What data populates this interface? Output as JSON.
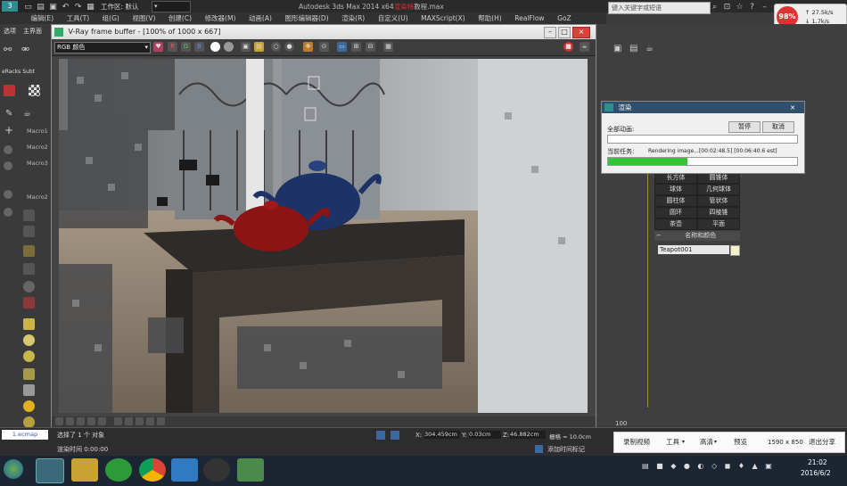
{
  "app": {
    "title_prefix": "Autodesk 3ds Max 2014 x64",
    "title_highlight": "渲染特",
    "title_suffix": "教程.max",
    "workspace_label": "工作区: 默认"
  },
  "menu": [
    "编辑(E)",
    "工具(T)",
    "组(G)",
    "视图(V)",
    "创建(C)",
    "修改器(M)",
    "动画(A)",
    "图形编辑器(D)",
    "渲染(R)",
    "自定义(U)",
    "MAXScript(X)",
    "帮助(H)",
    "RealFlow",
    "GoZ"
  ],
  "search": {
    "placeholder": "键入关键字或短语"
  },
  "net": {
    "cpu": "98%",
    "up": "27.5k/s",
    "down": "1.7k/s"
  },
  "left": {
    "tabs": [
      "选项",
      "主界面"
    ],
    "sub": "eRacks Subt",
    "macros": [
      "Macro1",
      "Macro2",
      "Macro3",
      "Macro2"
    ]
  },
  "vfb": {
    "title": "V-Ray frame buffer - [100% of 1000 x 667]",
    "channel": "RGB 颜色",
    "btn_r": "R",
    "btn_g": "G",
    "btn_b": "B"
  },
  "render_dialog": {
    "title": "渲染",
    "total_label": "全部动画:",
    "pause": "暂停",
    "cancel": "取消",
    "current_label": "当前任务:",
    "current_text": "Rendering image...[00:02:48.5] [00:06:40.6 est]",
    "total_progress": 0.0,
    "current_progress": 0.42
  },
  "primitives": [
    [
      "长方体",
      "圆锥体"
    ],
    [
      "球体",
      "几何球体"
    ],
    [
      "圆柱体",
      "管状体"
    ],
    [
      "圆环",
      "四棱锥"
    ],
    [
      "茶壶",
      "平面"
    ]
  ],
  "name_color": {
    "header": "名称和颜色",
    "object_name": "Teapot001",
    "swatch": "#f5f1c8"
  },
  "timeline": {
    "tick": "100"
  },
  "status": {
    "selected": "选择了 1 个 对象",
    "render_time": "渲染时间 0:00:00",
    "x_label": "X:",
    "x": "304.459cm",
    "y_label": "Y:",
    "y": "0.03cm",
    "z_label": "Z:",
    "z": "46.882cm",
    "grid": "栅格 = 10.0cm",
    "add_time_tag": "添加时间标记",
    "tab_label": "1.ecmap"
  },
  "recorder": {
    "record": "录制视频",
    "tools": "工具",
    "quality": "高清",
    "preview": "预览",
    "resolution": "1590 x 850",
    "exit": "退出分享"
  },
  "taskbar": {
    "time": "21:02",
    "date": "2016/6/2"
  }
}
